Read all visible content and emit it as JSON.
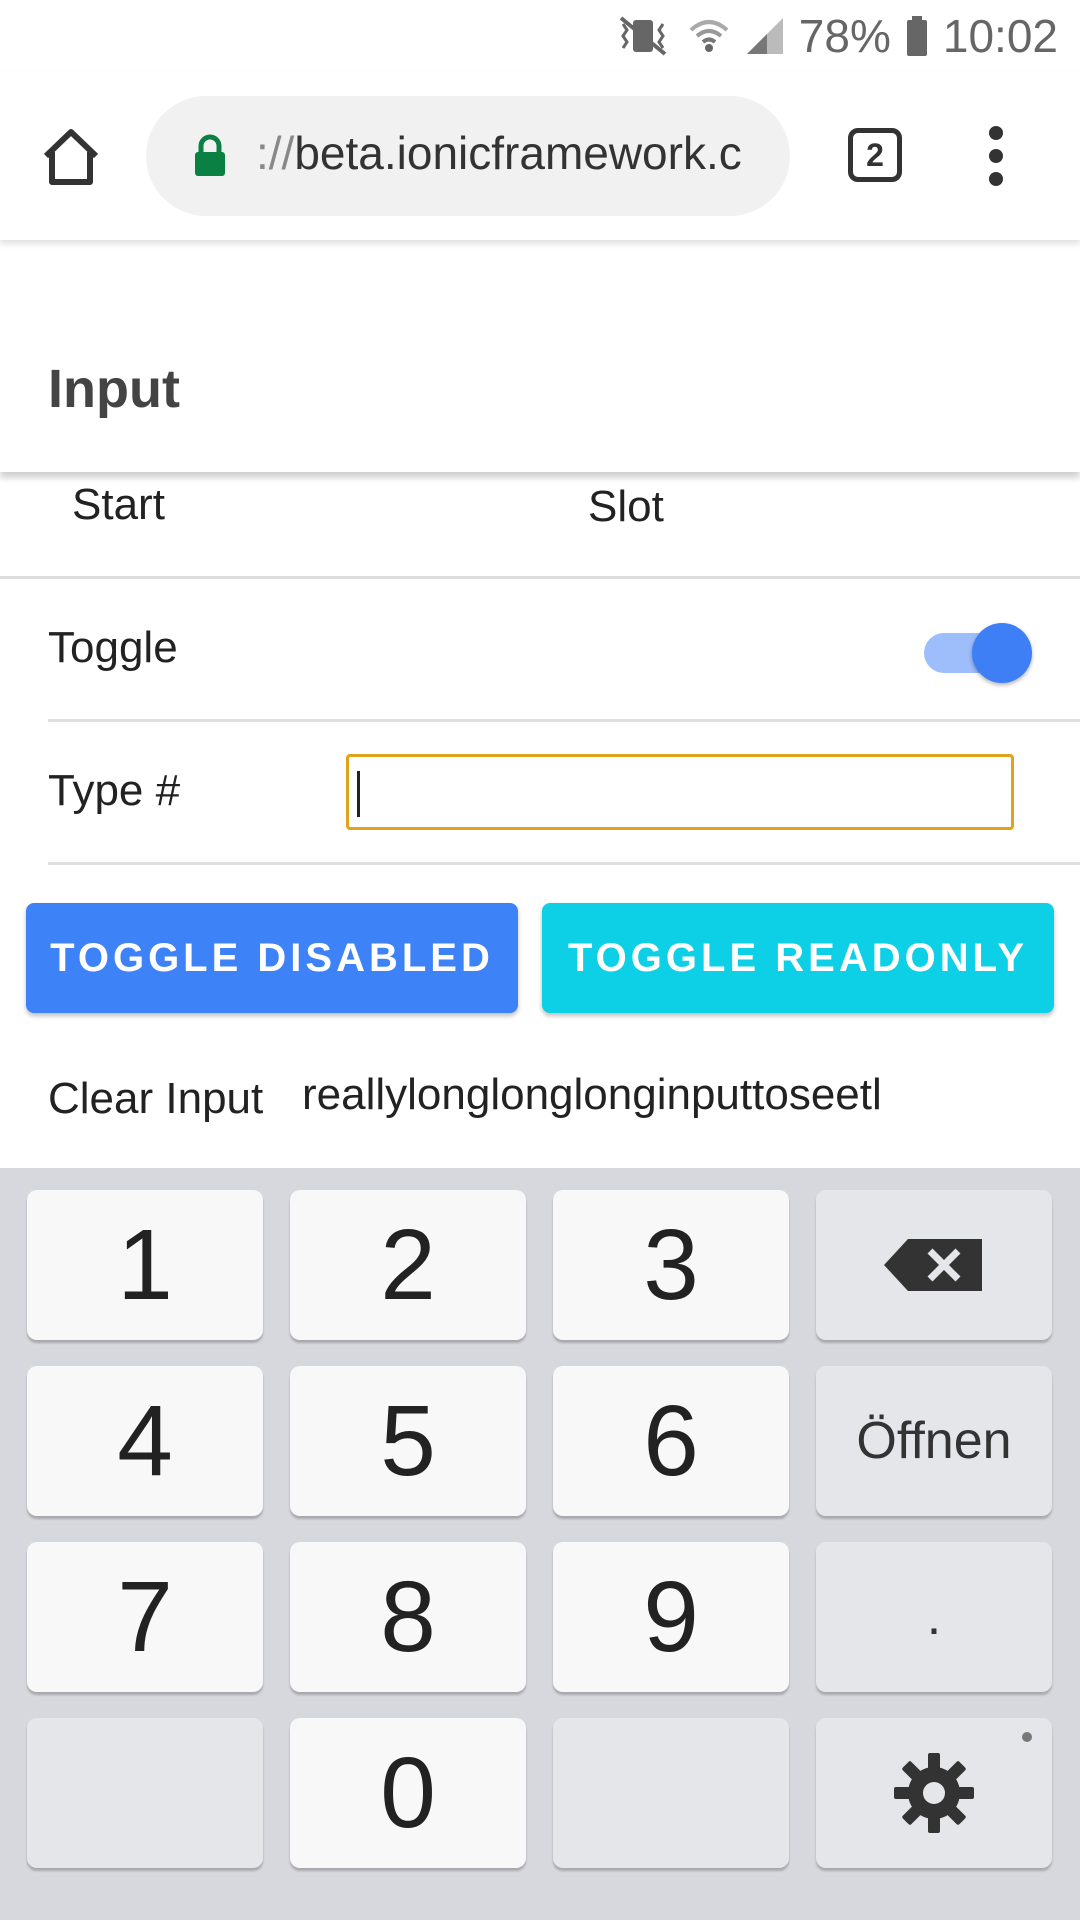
{
  "status_bar": {
    "battery": "78%",
    "time": "10:02"
  },
  "browser": {
    "url_scheme": "://",
    "url_host": "beta.ionicframework.c",
    "tab_count": "2"
  },
  "page": {
    "title": "Input"
  },
  "content": {
    "slot_start": "Start",
    "slot_middle": "Slot",
    "toggle_label": "Toggle",
    "toggle_checked": true,
    "type_label": "Type #",
    "type_value": "",
    "btn_toggle_disabled": "TOGGLE DISABLED",
    "btn_toggle_readonly": "TOGGLE READONLY",
    "clear_label": "Clear Input",
    "clear_value": "reallylonglonglonginputtoseetl"
  },
  "keyboard": {
    "k1": "1",
    "k2": "2",
    "k3": "3",
    "k4": "4",
    "k5": "5",
    "k6": "6",
    "k7": "7",
    "k8": "8",
    "k9": "9",
    "k0": "0",
    "open": "Öffnen",
    "period": "."
  },
  "colors": {
    "primary": "#3d82f7",
    "secondary": "#0dcfe6",
    "focus_border": "#e2a21c"
  }
}
